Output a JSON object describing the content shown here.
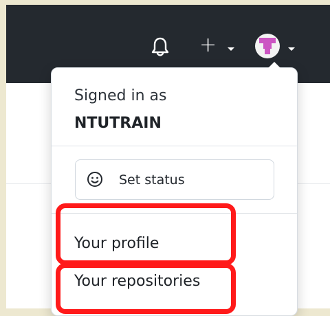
{
  "header": {
    "notifications_icon": "bell-icon",
    "create_icon": "plus-icon",
    "create_caret": "chevron-down-icon",
    "avatar_caret": "chevron-down-icon"
  },
  "user_menu": {
    "signed_in_label": "Signed in as",
    "username": "NTUTRAIN",
    "status_icon": "smiley-icon",
    "set_status_label": "Set status",
    "items": [
      {
        "label": "Your profile"
      },
      {
        "label": "Your repositories"
      }
    ]
  },
  "colors": {
    "header_bg": "#24292f",
    "highlight": "#ff1a1a",
    "page_bg": "#ede8d0"
  }
}
